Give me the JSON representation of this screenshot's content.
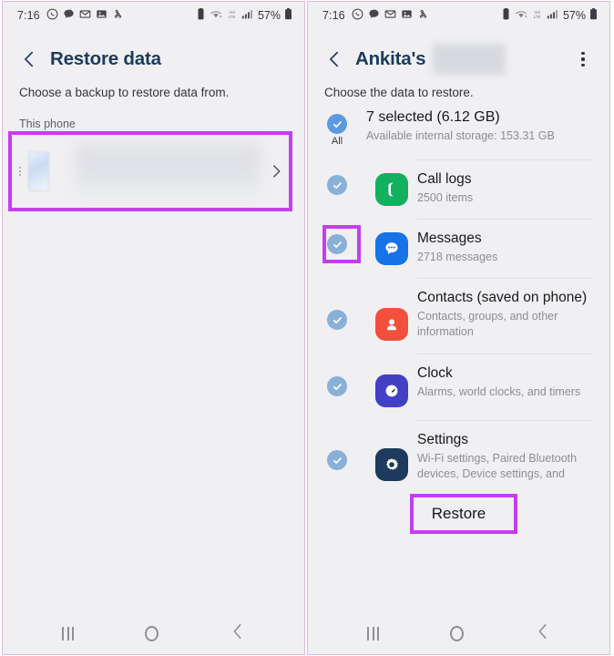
{
  "meta": {
    "accent_highlight": "#c63df0",
    "title_color": "#1b3a5c",
    "checkbox_color": "#89b0d8",
    "checkbox_all_color": "#5b9ae0",
    "screen_bg": "#f0f0f3"
  },
  "status_bar": {
    "time": "7:16",
    "left_icons": [
      "whatsapp-icon",
      "chat-bubble-icon",
      "gmail-icon",
      "gallery-icon",
      "share-icon"
    ],
    "right_icons": [
      "alarm-icon",
      "wifi-icon",
      "volte-icon",
      "signal-icon"
    ],
    "battery_percent": "57%",
    "battery_icon": "battery-icon"
  },
  "left_screen": {
    "back_icon": "back-chevron-icon",
    "title": "Restore data",
    "subtitle": "Choose a backup to restore data from.",
    "section_label": "This phone",
    "device_row": {
      "name_redacted": true,
      "thumbnail": "phone-thumbnail-image",
      "chevron_icon": "chevron-right-icon",
      "highlighted": true
    }
  },
  "right_screen": {
    "back_icon": "back-chevron-icon",
    "title": "Ankita's",
    "title_redacted_suffix": true,
    "menu_icon": "kebab-menu-icon",
    "subtitle": "Choose the data to restore.",
    "summary": {
      "checkbox_label": "All",
      "title": "7 selected (6.12 GB)",
      "subtitle": "Available internal storage: 153.31 GB",
      "checked": true
    },
    "items": [
      {
        "icon": "call-logs-icon",
        "icon_bg": "#12b05f",
        "title": "Call logs",
        "subtitle": "2500 items",
        "checked": true,
        "highlighted": false
      },
      {
        "icon": "messages-icon",
        "icon_bg": "#1673e8",
        "title": "Messages",
        "subtitle": "2718 messages",
        "checked": true,
        "highlighted": true
      },
      {
        "icon": "contacts-icon",
        "icon_bg": "#f2503c",
        "title": "Contacts (saved on phone)",
        "subtitle": "Contacts, groups, and other information",
        "checked": true,
        "highlighted": false
      },
      {
        "icon": "clock-icon",
        "icon_bg": "#4340c4",
        "title": "Clock",
        "subtitle": "Alarms, world clocks, and timers",
        "checked": true,
        "highlighted": false
      },
      {
        "icon": "settings-gear-icon",
        "icon_bg": "#1d3b5c",
        "title": "Settings",
        "subtitle": "Wi-Fi settings, Paired Bluetooth devices, Device settings, and ringtones",
        "checked": true,
        "highlighted": false
      }
    ],
    "restore_button": {
      "label": "Restore",
      "highlighted": true
    }
  },
  "nav_bar": {
    "recents_icon": "recents-icon",
    "home_icon": "home-icon",
    "back_icon": "back-icon"
  }
}
